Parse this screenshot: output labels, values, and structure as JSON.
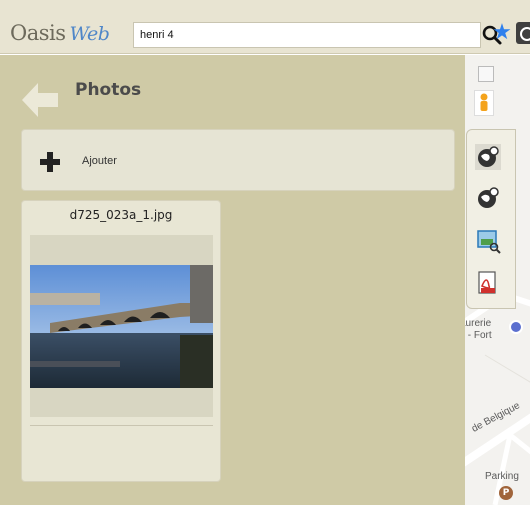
{
  "header": {
    "logo_main": "Oasis",
    "logo_accent": "Web",
    "search_value": "henri 4"
  },
  "panel": {
    "title": "Photos",
    "add_label": "Ajouter"
  },
  "photo": {
    "filename": "d725_023a_1.jpg"
  },
  "map": {
    "label_shop_line1": "aurerie",
    "label_shop_line2": "s - Fort",
    "label_street": "de Belgique",
    "label_parking": "Parking",
    "parking_letter": "P"
  },
  "colors": {
    "header_bg": "#e8e4d2",
    "panel_bg": "#cfcaa6",
    "accent_blue": "#4f86c8",
    "star_blue": "#2f80ed"
  }
}
